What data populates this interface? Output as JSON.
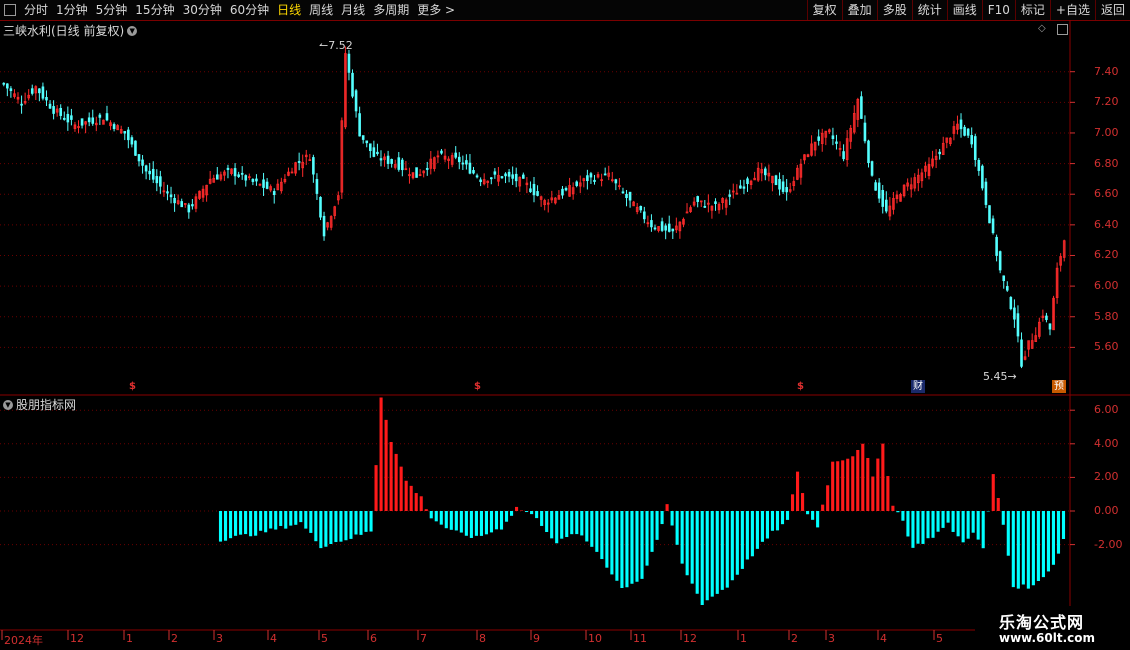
{
  "toolbar": {
    "periods": [
      "分时",
      "1分钟",
      "5分钟",
      "15分钟",
      "30分钟",
      "60分钟",
      "日线",
      "周线",
      "月线",
      "多周期",
      "更多 >"
    ],
    "active_index": 6,
    "right_buttons": [
      "复权",
      "叠加",
      "多股",
      "统计",
      "画线",
      "F10",
      "标记",
      "+自选",
      "返回"
    ]
  },
  "main_panel": {
    "title": "三峡水利(日线 前复权)",
    "price_axis": [
      "7.40",
      "7.20",
      "7.00",
      "6.80",
      "6.60",
      "6.40",
      "6.20",
      "6.00",
      "5.80",
      "5.60"
    ],
    "high_label": "7.52",
    "low_label": "5.45",
    "markers": [
      {
        "text": "$",
        "x": 0.129
      },
      {
        "text": "$",
        "x": 0.474
      },
      {
        "text": "$",
        "x": 0.797
      }
    ],
    "badges": [
      {
        "text": "财",
        "bg": "#1a2a6a",
        "color": "#ffffff"
      },
      {
        "text": "预",
        "bg": "#c85a00",
        "color": "#ffffff"
      }
    ],
    "colors": {
      "up": "#ff2b2b",
      "down": "#54ffff"
    }
  },
  "indicator_panel": {
    "title": "股朋指标网",
    "axis": [
      "6.00",
      "4.00",
      "2.00",
      "0.00",
      "-2.00"
    ],
    "colors": {
      "positive": "#ff1a1a",
      "negative": "#00ffff"
    }
  },
  "date_axis": [
    "2024年",
    "12",
    "1",
    "2",
    "3",
    "4",
    "5",
    "6",
    "7",
    "8",
    "9",
    "10",
    "11",
    "12",
    "1",
    "2",
    "3",
    "4",
    "5"
  ],
  "watermark": {
    "line1": "乐淘公式网",
    "line2": "www.60lt.com"
  },
  "chart_data": {
    "type": "candlestick",
    "ylim": [
      5.4,
      7.62
    ],
    "close_anchors": [
      [
        0,
        7.32
      ],
      [
        5,
        7.2
      ],
      [
        9,
        7.3
      ],
      [
        14,
        7.15
      ],
      [
        20,
        7.05
      ],
      [
        28,
        7.1
      ],
      [
        34,
        7.0
      ],
      [
        40,
        6.75
      ],
      [
        46,
        6.6
      ],
      [
        52,
        6.5
      ],
      [
        58,
        6.7
      ],
      [
        64,
        6.75
      ],
      [
        70,
        6.68
      ],
      [
        76,
        6.62
      ],
      [
        82,
        6.8
      ],
      [
        86,
        6.85
      ],
      [
        90,
        6.35
      ],
      [
        94,
        6.6
      ],
      [
        96,
        7.52
      ],
      [
        100,
        7.0
      ],
      [
        104,
        6.85
      ],
      [
        110,
        6.8
      ],
      [
        116,
        6.72
      ],
      [
        122,
        6.85
      ],
      [
        128,
        6.82
      ],
      [
        134,
        6.7
      ],
      [
        140,
        6.72
      ],
      [
        146,
        6.68
      ],
      [
        152,
        6.55
      ],
      [
        158,
        6.62
      ],
      [
        164,
        6.7
      ],
      [
        170,
        6.72
      ],
      [
        176,
        6.55
      ],
      [
        182,
        6.4
      ],
      [
        188,
        6.35
      ],
      [
        194,
        6.55
      ],
      [
        200,
        6.52
      ],
      [
        206,
        6.62
      ],
      [
        212,
        6.75
      ],
      [
        216,
        6.7
      ],
      [
        220,
        6.6
      ],
      [
        224,
        6.8
      ],
      [
        228,
        6.95
      ],
      [
        232,
        7.0
      ],
      [
        236,
        6.85
      ],
      [
        240,
        7.22
      ],
      [
        244,
        6.7
      ],
      [
        248,
        6.48
      ],
      [
        252,
        6.62
      ],
      [
        256,
        6.7
      ],
      [
        260,
        6.78
      ],
      [
        264,
        6.92
      ],
      [
        268,
        7.05
      ],
      [
        272,
        6.95
      ],
      [
        276,
        6.55
      ],
      [
        280,
        6.1
      ],
      [
        284,
        5.8
      ],
      [
        286,
        5.5
      ],
      [
        288,
        5.62
      ],
      [
        290,
        5.7
      ],
      [
        292,
        5.82
      ],
      [
        294,
        5.72
      ],
      [
        296,
        6.1
      ],
      [
        298,
        6.3
      ]
    ],
    "indicator_anchors": [
      [
        0,
        -1.7
      ],
      [
        8,
        -1.3
      ],
      [
        16,
        -0.7
      ],
      [
        20,
        -2.1
      ],
      [
        26,
        -1.6
      ],
      [
        30,
        -1.2
      ],
      [
        32,
        6.8
      ],
      [
        34,
        4.2
      ],
      [
        37,
        1.8
      ],
      [
        40,
        0.8
      ],
      [
        42,
        -0.4
      ],
      [
        46,
        -1.2
      ],
      [
        51,
        -1.6
      ],
      [
        56,
        -1.0
      ],
      [
        59,
        0.2
      ],
      [
        62,
        -0.2
      ],
      [
        64,
        -0.8
      ],
      [
        67,
        -1.9
      ],
      [
        71,
        -1.3
      ],
      [
        75,
        -2.4
      ],
      [
        80,
        -4.6
      ],
      [
        84,
        -4.0
      ],
      [
        88,
        -0.9
      ],
      [
        89,
        0.3
      ],
      [
        92,
        -3.2
      ],
      [
        96,
        -5.5
      ],
      [
        101,
        -4.5
      ],
      [
        106,
        -2.6
      ],
      [
        110,
        -1.3
      ],
      [
        113,
        -0.6
      ],
      [
        115,
        2.4
      ],
      [
        117,
        -0.2
      ],
      [
        119,
        -0.9
      ],
      [
        122,
        2.9
      ],
      [
        126,
        3.3
      ],
      [
        128,
        4.1
      ],
      [
        130,
        2.0
      ],
      [
        132,
        4.0
      ],
      [
        134,
        0.4
      ],
      [
        136,
        -0.6
      ],
      [
        138,
        -2.2
      ],
      [
        142,
        -1.5
      ],
      [
        145,
        -0.8
      ],
      [
        148,
        -1.9
      ],
      [
        150,
        -1.2
      ],
      [
        152,
        -2.3
      ],
      [
        154,
        2.2
      ],
      [
        156,
        -0.8
      ],
      [
        158,
        -4.5
      ],
      [
        162,
        -4.5
      ],
      [
        166,
        -3.2
      ],
      [
        168,
        -1.7
      ]
    ]
  }
}
